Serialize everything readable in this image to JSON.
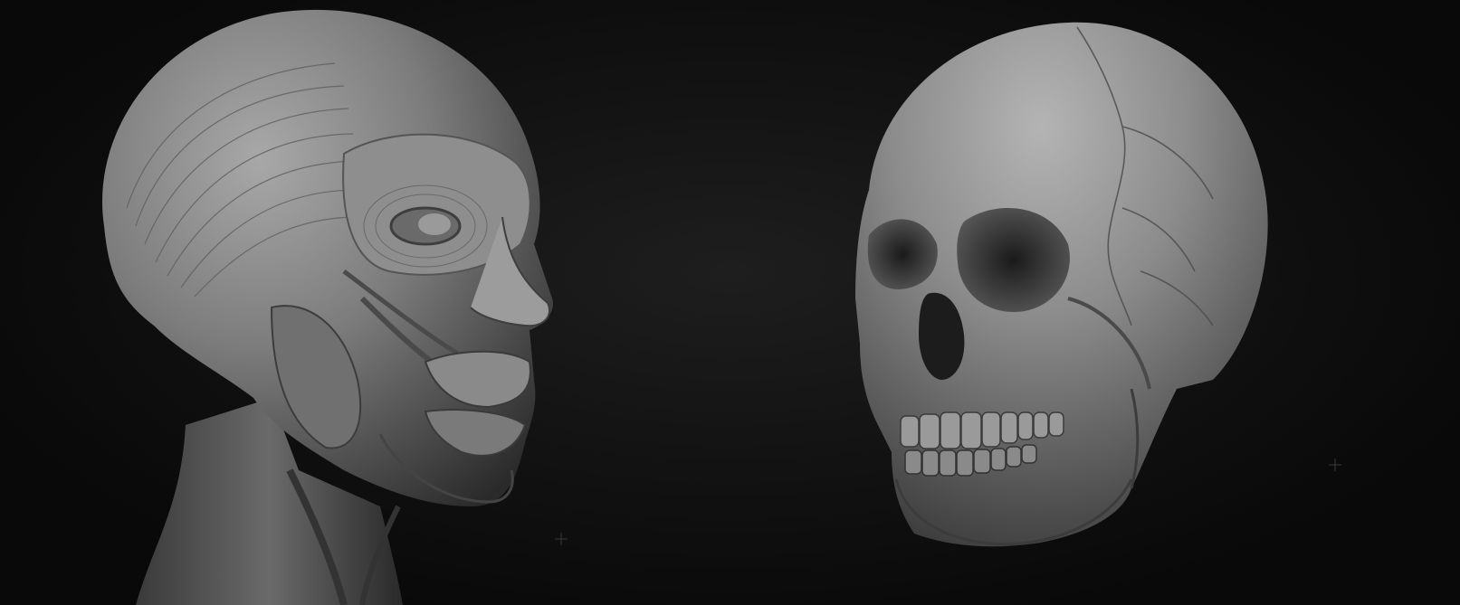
{
  "scene": {
    "background_color": "#0b0b0b",
    "model_color": "#8a8a8a",
    "subjects": [
      {
        "name": "ecorche-head",
        "icon": "muscle-head-sculpt"
      },
      {
        "name": "skull",
        "icon": "skull-sculpt"
      }
    ],
    "markers": [
      "crosshair-marker",
      "crosshair-marker"
    ]
  }
}
